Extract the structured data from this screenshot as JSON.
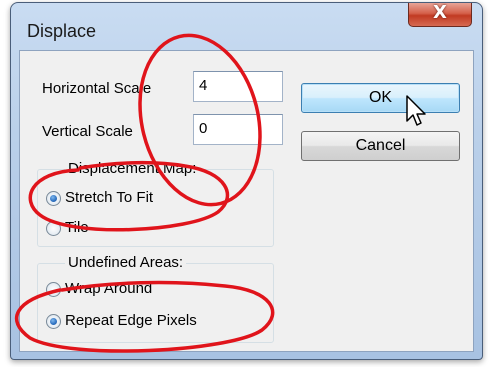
{
  "window": {
    "title": "Displace",
    "close_glyph": "X"
  },
  "scale": {
    "horizontal_label": "Horizontal Scale",
    "horizontal_value": "4",
    "vertical_label": "Vertical Scale",
    "vertical_value": "0"
  },
  "buttons": {
    "ok_label": "OK",
    "cancel_label": "Cancel"
  },
  "displacement_map": {
    "title": "Displacement Map:",
    "options": [
      {
        "label": "Stretch To Fit",
        "checked": true
      },
      {
        "label": "Tile",
        "checked": false
      }
    ]
  },
  "undefined_areas": {
    "title": "Undefined Areas:",
    "options": [
      {
        "label": "Wrap Around",
        "checked": false
      },
      {
        "label": "Repeat Edge Pixels",
        "checked": true
      }
    ]
  },
  "annotation": {
    "color": "#e0141b"
  },
  "icons": {
    "close": "close-icon",
    "cursor": "mouse-pointer-icon"
  }
}
